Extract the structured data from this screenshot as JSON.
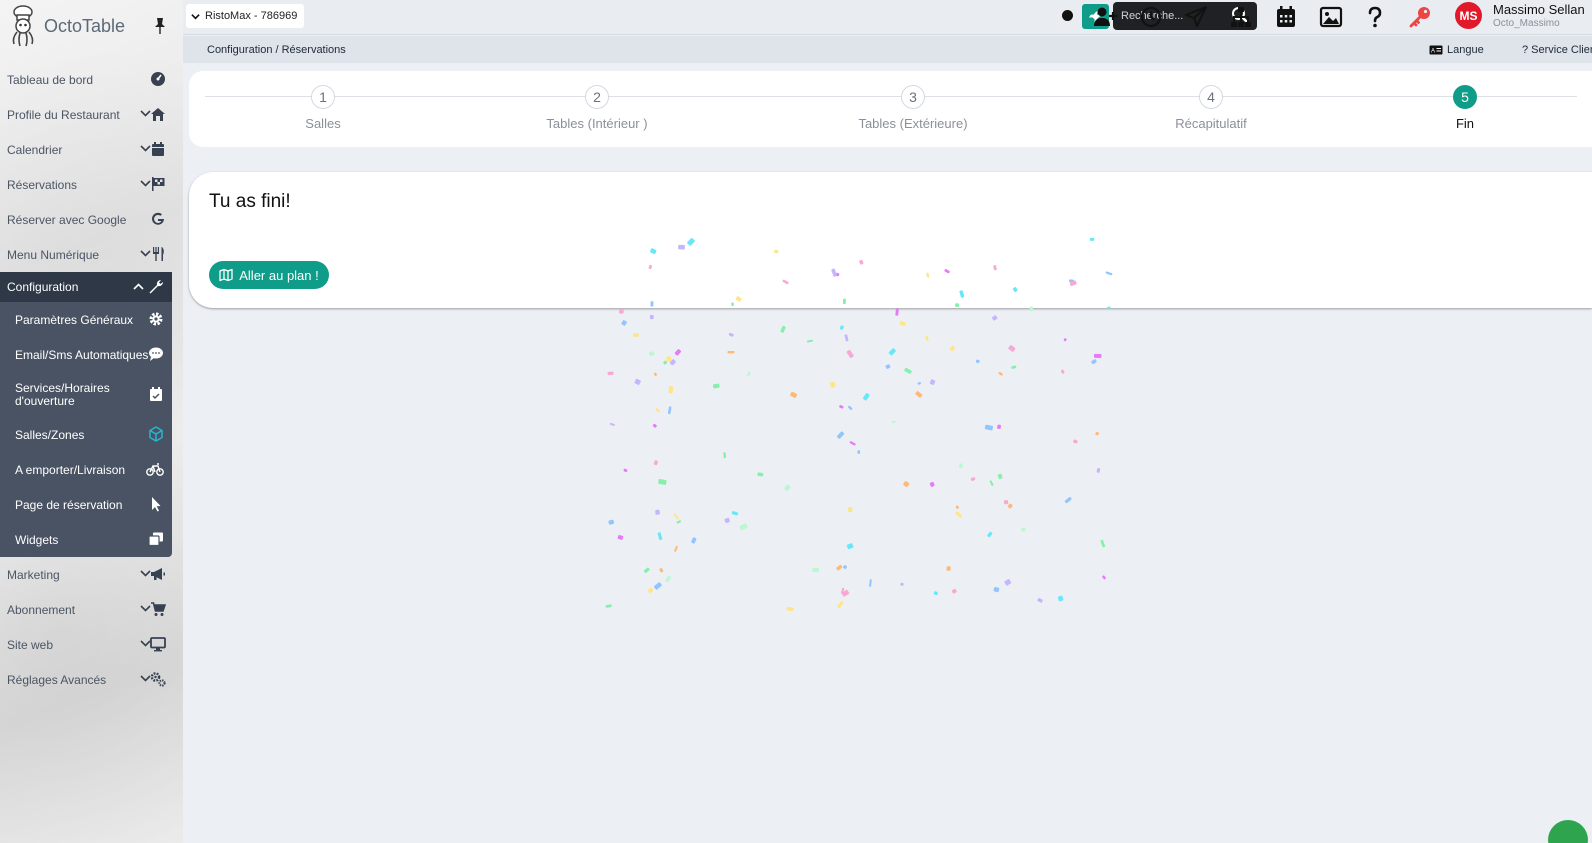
{
  "app": {
    "name": "OctoTable"
  },
  "sidebar": {
    "items": [
      {
        "label": "Tableau de bord",
        "icon": "dashboard-icon",
        "chevron": false
      },
      {
        "label": "Profile du Restaurant",
        "icon": "home-icon",
        "chevron": true
      },
      {
        "label": "Calendrier",
        "icon": "calendar-icon",
        "chevron": true
      },
      {
        "label": "Réservations",
        "icon": "flag-checkered-icon",
        "chevron": true
      },
      {
        "label": "Réserver avec Google",
        "icon": "google-icon",
        "chevron": false
      },
      {
        "label": "Menu Numérique",
        "icon": "utensils-icon",
        "chevron": true
      }
    ],
    "configuration": {
      "label": "Configuration",
      "icon": "wrench-icon",
      "subitems": [
        {
          "label": "Paramètres Généraux",
          "icon": "gear-icon"
        },
        {
          "label": "Email/Sms Automatiques",
          "icon": "chat-icon"
        },
        {
          "label": "Services/Horaires d'ouverture",
          "icon": "calendar-check-icon"
        },
        {
          "label": "Salles/Zones",
          "icon": "cube-icon",
          "active": true
        },
        {
          "label": "A emporter/Livraison",
          "icon": "bicycle-icon"
        },
        {
          "label": "Page de réservation",
          "icon": "cursor-icon"
        },
        {
          "label": "Widgets",
          "icon": "windows-icon"
        }
      ]
    },
    "bottom_items": [
      {
        "label": "Marketing",
        "icon": "megaphone-icon"
      },
      {
        "label": "Abonnement",
        "icon": "cart-icon"
      },
      {
        "label": "Site web",
        "icon": "monitor-icon"
      },
      {
        "label": "Réglages Avancés",
        "icon": "gears-icon"
      }
    ]
  },
  "topbar": {
    "restaurant": "RistoMax - 786969",
    "search_placeholder": "Recherche...",
    "user": {
      "initials": "MS",
      "name": "Massimo Sellan",
      "handle": "Octo_Massimo"
    },
    "accent_color": "#0f9d8a",
    "avatar_color": "#e1192b"
  },
  "breadcrumb": {
    "path": "Configuration / Réservations",
    "language": "Langue",
    "support": "? Service Client"
  },
  "stepper": {
    "steps": [
      {
        "num": "1",
        "label": "Salles"
      },
      {
        "num": "2",
        "label": "Tables (Intérieur )"
      },
      {
        "num": "3",
        "label": "Tables (Extérieure)"
      },
      {
        "num": "4",
        "label": "Récapitulatif"
      },
      {
        "num": "5",
        "label": "Fin",
        "active": true
      }
    ]
  },
  "finish": {
    "title": "Tu as fini!",
    "button": "Aller au plan !"
  }
}
